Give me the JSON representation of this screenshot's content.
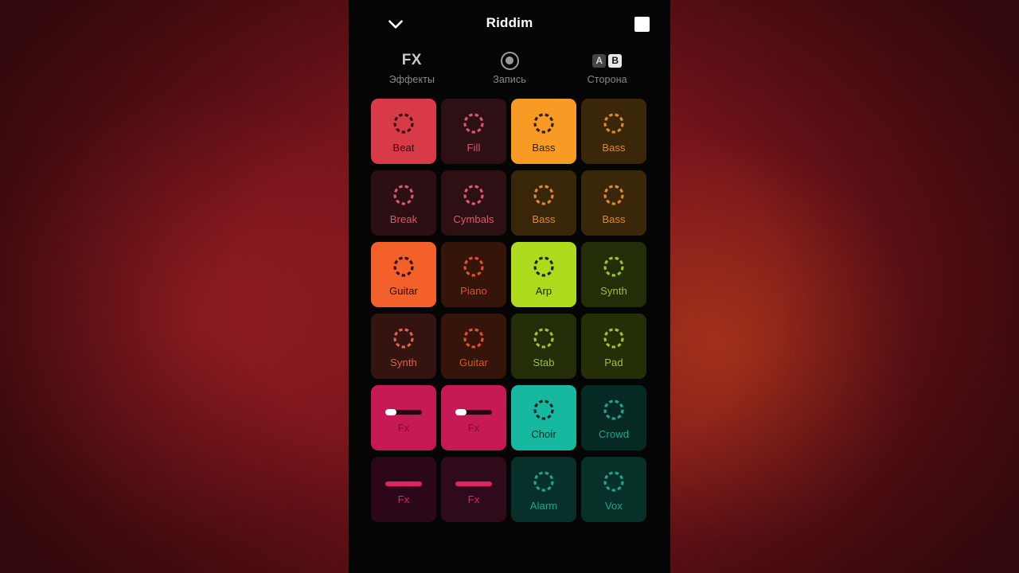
{
  "header": {
    "title": "Riddim",
    "chevron_icon": "chevron-down-icon",
    "stop_icon": "stop-square-icon"
  },
  "toolbar": [
    {
      "id": "effects",
      "glyph": "FX",
      "icon": "fx-text-icon",
      "label": "Эффекты"
    },
    {
      "id": "record",
      "glyph": "",
      "icon": "record-circle-icon",
      "label": "Запись"
    },
    {
      "id": "side",
      "glyph": "",
      "icon": "ab-side-icon",
      "label": "Сторона",
      "badges": [
        {
          "text": "A",
          "active": false
        },
        {
          "text": "B",
          "active": true
        }
      ]
    }
  ],
  "colors": {
    "red_active": "#d93a48",
    "red_idle_bg": "#2d1013",
    "red_idle_fg": "#d9596a",
    "pink_active": "#c61a56",
    "pink_idle_bg": "#2b0719",
    "pink_idle_fg": "#e02463",
    "orange_active": "#f89b24",
    "orange_idle_bg": "#3a2609",
    "orange_idle_fg": "#e0892a",
    "orangered_active": "#f4602a",
    "orangered_idle_bg": "#3a1409",
    "orangered_idle_fg": "#e2512a",
    "lime_active": "#aedb1e",
    "lime_idle_bg": "#232d07",
    "lime_idle_fg": "#9dc428",
    "teal_active": "#17b8a0",
    "teal_idle_bg": "#062723",
    "teal_idle_fg": "#1aa791",
    "dark_text": "#1a1008"
  },
  "grid": {
    "columns": 4,
    "rows": 6,
    "pads": [
      {
        "label": "Beat",
        "icon": "dashed-circle-icon",
        "active": true,
        "bg": "#d93a48",
        "fg": "#2a0c10"
      },
      {
        "label": "Fill",
        "icon": "dashed-circle-icon",
        "active": false,
        "bg": "#2d1013",
        "fg": "#d9596a"
      },
      {
        "label": "Bass",
        "icon": "dashed-circle-icon",
        "active": true,
        "bg": "#f89b24",
        "fg": "#2e1c03"
      },
      {
        "label": "Bass",
        "icon": "dashed-circle-icon",
        "active": false,
        "bg": "#3a2609",
        "fg": "#e0892a"
      },
      {
        "label": "Break",
        "icon": "dashed-circle-icon",
        "active": false,
        "bg": "#2b0f12",
        "fg": "#d9596a"
      },
      {
        "label": "Cymbals",
        "icon": "dashed-circle-icon",
        "active": false,
        "bg": "#2d1013",
        "fg": "#e2576b"
      },
      {
        "label": "Bass",
        "icon": "dashed-circle-icon",
        "active": false,
        "bg": "#392508",
        "fg": "#e0892a"
      },
      {
        "label": "Bass",
        "icon": "dashed-circle-icon",
        "active": false,
        "bg": "#3a2609",
        "fg": "#e0892a"
      },
      {
        "label": "Guitar",
        "icon": "dashed-circle-icon",
        "active": true,
        "bg": "#f4602a",
        "fg": "#2d0c04"
      },
      {
        "label": "Piano",
        "icon": "dashed-circle-icon",
        "active": false,
        "bg": "#351409",
        "fg": "#e2512a"
      },
      {
        "label": "Arp",
        "icon": "dashed-circle-icon",
        "active": true,
        "bg": "#aedb1e",
        "fg": "#1c2405"
      },
      {
        "label": "Synth",
        "icon": "dashed-circle-icon",
        "active": false,
        "bg": "#232d07",
        "fg": "#9dc428"
      },
      {
        "label": "Synth",
        "icon": "dashed-circle-icon",
        "active": false,
        "bg": "#331410",
        "fg": "#e2614a"
      },
      {
        "label": "Guitar",
        "icon": "dashed-circle-icon",
        "active": false,
        "bg": "#351409",
        "fg": "#e2512a"
      },
      {
        "label": "Stab",
        "icon": "dashed-circle-icon",
        "active": false,
        "bg": "#232d07",
        "fg": "#9dc428"
      },
      {
        "label": "Pad",
        "icon": "dashed-circle-icon",
        "active": false,
        "bg": "#242f08",
        "fg": "#9dc428"
      },
      {
        "label": "Fx",
        "icon": "slider-icon",
        "active": true,
        "bg": "#c61a56",
        "fg": "#7d0b33",
        "slider": {
          "knob": true,
          "track": "#2a0512"
        }
      },
      {
        "label": "Fx",
        "icon": "slider-icon",
        "active": true,
        "bg": "#c61a56",
        "fg": "#7d0b33",
        "slider": {
          "knob": true,
          "track": "#2a0512"
        }
      },
      {
        "label": "Choir",
        "icon": "dashed-circle-icon",
        "active": true,
        "bg": "#17b8a0",
        "fg": "#05251f"
      },
      {
        "label": "Crowd",
        "icon": "dashed-circle-icon",
        "active": false,
        "bg": "#062924",
        "fg": "#1aa791"
      },
      {
        "label": "Fx",
        "icon": "slider-icon",
        "active": false,
        "bg": "#2b0719",
        "fg": "#e02463",
        "slider": {
          "knob": false,
          "track": "#e02463"
        }
      },
      {
        "label": "Fx",
        "icon": "slider-icon",
        "active": false,
        "bg": "#2e0a1b",
        "fg": "#e02463",
        "slider": {
          "knob": false,
          "track": "#e02463"
        }
      },
      {
        "label": "Alarm",
        "icon": "dashed-circle-icon",
        "active": false,
        "bg": "#07302a",
        "fg": "#1aa791"
      },
      {
        "label": "Vox",
        "icon": "dashed-circle-icon",
        "active": false,
        "bg": "#073029",
        "fg": "#1aa791"
      }
    ]
  }
}
